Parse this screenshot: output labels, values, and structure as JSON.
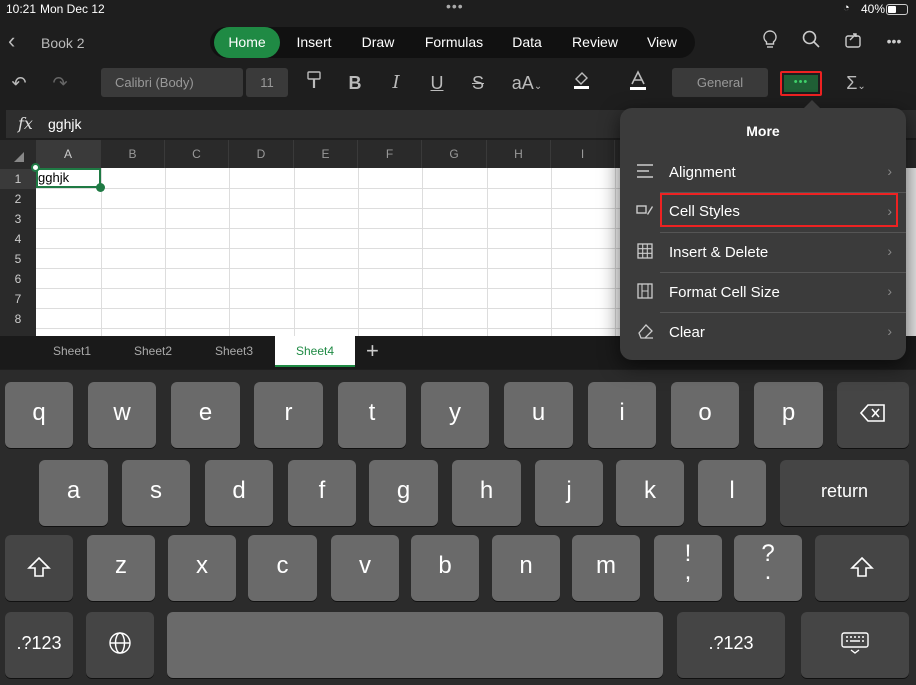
{
  "status": {
    "time": "10:21",
    "date": "Mon Dec 12",
    "battery": "40%"
  },
  "app": {
    "doc_title": "Book 2"
  },
  "tabs": [
    "Home",
    "Insert",
    "Draw",
    "Formulas",
    "Data",
    "Review",
    "View"
  ],
  "toolbar": {
    "font": "Calibri (Body)",
    "size": "11",
    "number_format": "General",
    "more_dots": "•••"
  },
  "formula": {
    "fx": "fx",
    "value": "gghjk"
  },
  "grid": {
    "columns": [
      "A",
      "B",
      "C",
      "D",
      "E",
      "F",
      "G",
      "H",
      "I"
    ],
    "rows": [
      "1",
      "2",
      "3",
      "4",
      "5",
      "6",
      "7",
      "8"
    ],
    "cell_a1": "gghjk"
  },
  "sheets": [
    "Sheet1",
    "Sheet2",
    "Sheet3",
    "Sheet4"
  ],
  "more_menu": {
    "title": "More",
    "items": [
      "Alignment",
      "Cell Styles",
      "Insert & Delete",
      "Format Cell Size",
      "Clear"
    ]
  },
  "keyboard": {
    "row1": [
      "q",
      "w",
      "e",
      "r",
      "t",
      "y",
      "u",
      "i",
      "o",
      "p"
    ],
    "row2": [
      "a",
      "s",
      "d",
      "f",
      "g",
      "h",
      "j",
      "k",
      "l"
    ],
    "row3": [
      "z",
      "x",
      "c",
      "v",
      "b",
      "n",
      "m"
    ],
    "return": "return",
    "num": ".?123",
    "excl": "!",
    "comma": ",",
    "question": "?",
    "period": "."
  },
  "colors": {
    "accent": "#1f8a44",
    "highlight": "#e22222"
  }
}
